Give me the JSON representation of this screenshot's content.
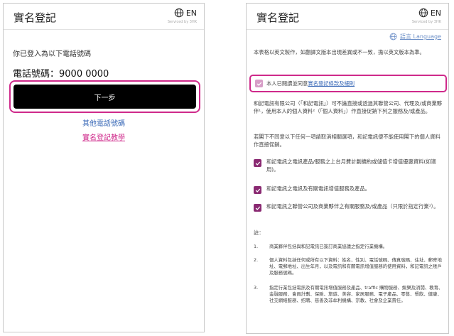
{
  "left": {
    "title": "實名登記",
    "lang_label": "EN",
    "serviced_by": "Serviced by 3HK",
    "intro": "你已登入為以下電話號碼",
    "phone_label": "電話號碼：9000 0000",
    "next_button": "下一步",
    "other_link": "其他電話號碼",
    "guide_link": "實名登記教學"
  },
  "right": {
    "title": "實名登記",
    "lang_label": "EN",
    "serviced_by": "Serviced by 3HK",
    "lang_switch": "語言 Language",
    "disclaimer": "本表格以英文製作，如翻譯文版本出現差異或不一致，擔以英文版本為準。",
    "agree_prefix": "本人已閱讀並同意",
    "agree_link": "實名登記條款及細則",
    "consent_para": "和記電訊有限公司（「和記電訊」）可不論直接或透過其聯營公司、代理及/或商業夥伴¹，使用本人的個人資料²（「個人資料」）作直接促銷下列之服務及/或產品。",
    "optout_para": "若閣下不同意以下任何一項請取消相關選項，和記電訊便不能使用閣下的個人資料作直接促銷。",
    "options": [
      {
        "label": "和記電訊之電訊產品/服務之上台月費計劃續約或儲值卡增值優惠資料(如適用)。",
        "checked": true
      },
      {
        "label": "和記電訊之電訊及有關電訊增值服務及產品。",
        "checked": true
      },
      {
        "label": "和記電訊之聯營公司及商業夥伴之有關服務及/或產品（只限於指定行業³）。",
        "checked": true
      }
    ],
    "notes_title": "註：",
    "notes": [
      {
        "num": "1.",
        "text": "商業夥伴包括與和記電訊已簽訂商業協議之指定行業機構。"
      },
      {
        "num": "2.",
        "text": "個人資料包括任何或所有以下資料：姓名、性別、電話號碼、傳真號碼、住址、郵寄地址、電郵地址、出生年月，以及電訊和有關電訊增值服務的使用資料，和記電訊之賬戶及服務號碼。"
      },
      {
        "num": "3.",
        "text": "指定行業包括電訊及有關電訊增值服務及產品、traffic 購物服務、娛樂及消閒、教育、金融服務、會員計劃、保險、旅遊、美容、家居服務、電子產品、零售、餐飲、健康、社交網絡服務、招聘、慈善及非牟利機構、宗教、社會及企業責任。"
      }
    ]
  }
}
